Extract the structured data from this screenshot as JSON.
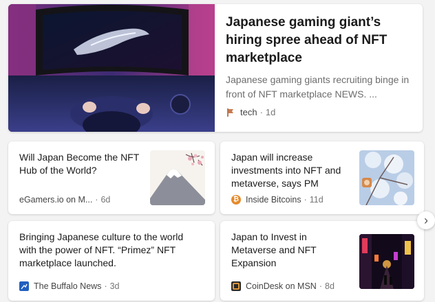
{
  "hero": {
    "title": "Japanese gaming giant’s hiring spree ahead of NFT marketplace",
    "description": "Japanese gaming giants recruiting binge in front of NFT marketplace NEWS. ...",
    "source": "tech",
    "age": "1d",
    "source_icon": "flag-icon"
  },
  "cards": [
    {
      "title": "Will Japan Become the NFT Hub of the World?",
      "source": "eGamers.io on M...",
      "age": "6d",
      "thumb": "mount-fuji-thumbnail"
    },
    {
      "title": "Japan will increase investments into NFT and metaverse, says PM",
      "source": "Inside Bitcoins",
      "age": "11d",
      "thumb": "cherry-blossom-thumbnail",
      "source_icon": "bitcoin-icon",
      "source_color": "#e58a2b"
    },
    {
      "title": "Bringing Japanese culture to the world with the power of NFT. “Primez” NFT marketplace launched.",
      "source": "The Buffalo News",
      "age": "3d",
      "source_icon": "buffalo-news-icon",
      "source_color": "#1f5fbf"
    },
    {
      "title": "Japan to Invest in Metaverse and NFT Expansion",
      "source": "CoinDesk on MSN",
      "age": "8d",
      "thumb": "tokyo-street-night-thumbnail",
      "source_icon": "coindesk-icon",
      "source_color": "#f2a23a"
    }
  ],
  "next_label": "›",
  "colors": {
    "background": "#f3f3f3",
    "card": "#ffffff",
    "title": "#1b1b1b",
    "meta": "#767676"
  }
}
